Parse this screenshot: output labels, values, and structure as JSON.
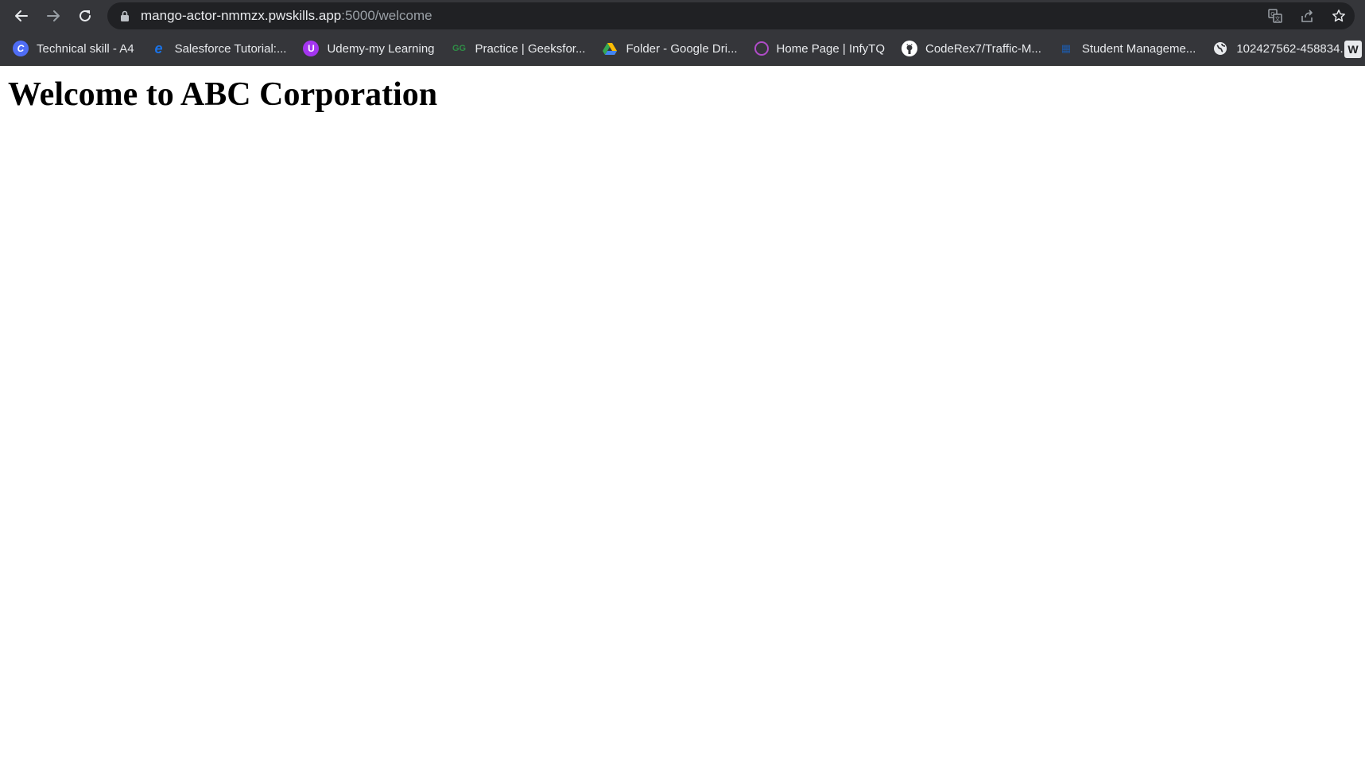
{
  "browser": {
    "url_host": "mango-actor-nmmzx.pwskills.app",
    "url_rest": ":5000/welcome",
    "nav_icons": [
      "back-arrow-icon",
      "forward-arrow-icon",
      "reload-icon"
    ],
    "omnibox_icons": [
      "lock-icon",
      "translate-icon",
      "share-icon",
      "star-icon"
    ]
  },
  "bookmarks": [
    {
      "label": "Technical skill - A4",
      "icon": "c-logo-icon",
      "color": "#4f6df5"
    },
    {
      "label": "Salesforce Tutorial:...",
      "icon": "e-logo-icon",
      "color": "#1a73e8"
    },
    {
      "label": "Udemy-my Learning",
      "icon": "udemy-icon",
      "color": "#a435f0"
    },
    {
      "label": "Practice | Geeksfor...",
      "icon": "geeksforgeeks-icon",
      "color": "#2f8d46"
    },
    {
      "label": "Folder - Google Dri...",
      "icon": "google-drive-icon",
      "color": "#fbbc04"
    },
    {
      "label": "Home Page | InfyTQ",
      "icon": "infytq-icon",
      "color": "#b04cc8"
    },
    {
      "label": "CodeRex7/Traffic-M...",
      "icon": "github-icon",
      "color": "#ffffff"
    },
    {
      "label": "Student Manageme...",
      "icon": "student-app-icon",
      "color": "#1e5aa8"
    },
    {
      "label": "102427562-458834...",
      "icon": "globe-icon",
      "color": "#e8eaed"
    }
  ],
  "page": {
    "heading": "Welcome to ABC Corporation"
  }
}
